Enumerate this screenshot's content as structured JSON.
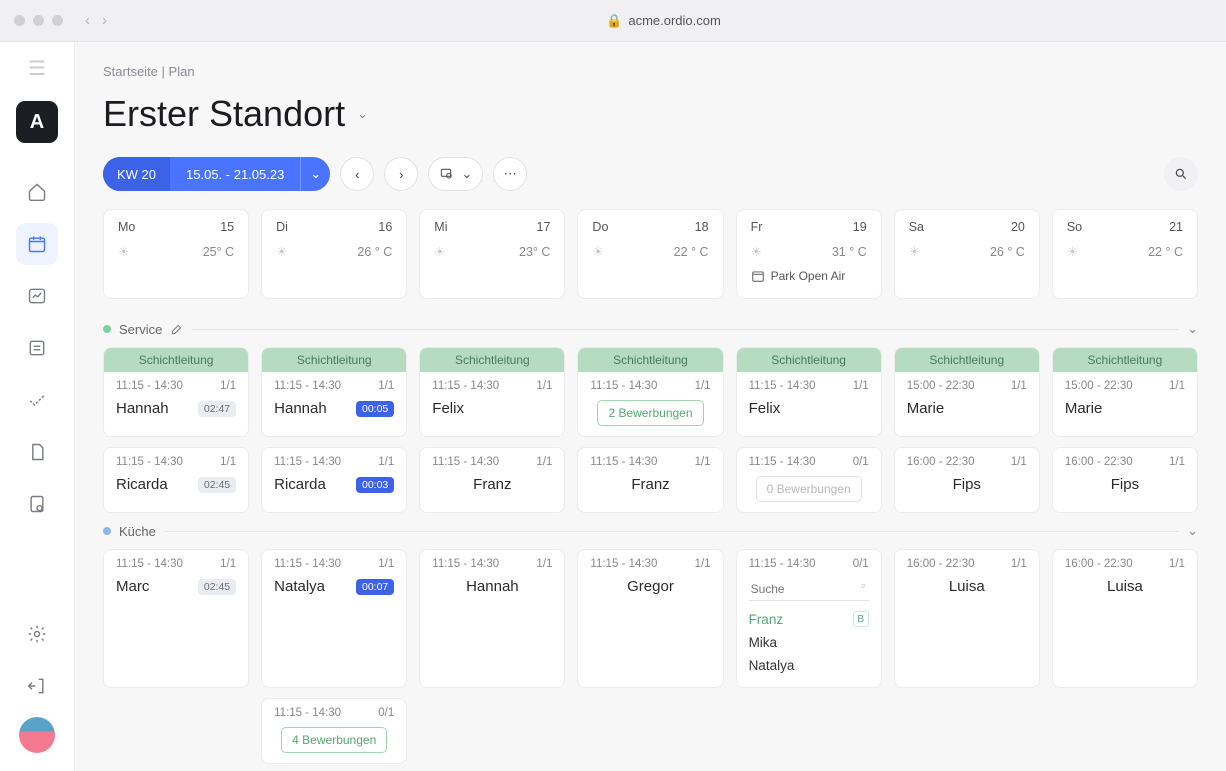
{
  "browser": {
    "url": "acme.ordio.com"
  },
  "logo": "A",
  "breadcrumb": [
    "Startseite",
    "Plan"
  ],
  "title": "Erster Standort",
  "week": {
    "kw": "KW 20",
    "range": "15.05. - 21.05.23"
  },
  "days": [
    {
      "short": "Mo",
      "num": "15",
      "temp": "25° C"
    },
    {
      "short": "Di",
      "num": "16",
      "temp": "26 ° C"
    },
    {
      "short": "Mi",
      "num": "17",
      "temp": "23° C"
    },
    {
      "short": "Do",
      "num": "18",
      "temp": "22 ° C"
    },
    {
      "short": "Fr",
      "num": "19",
      "temp": "31 ° C",
      "event": "Park Open Air"
    },
    {
      "short": "Sa",
      "num": "20",
      "temp": "26 ° C"
    },
    {
      "short": "So",
      "num": "21",
      "temp": "22 ° C"
    }
  ],
  "sections": {
    "service": {
      "label": "Service",
      "color": "#7bd39a",
      "leader_label": "Schichtleitung",
      "row1": [
        {
          "time": "11:15 - 14:30",
          "cap": "1/1",
          "name": "Hannah",
          "timer": "02:47",
          "timer_style": "grey"
        },
        {
          "time": "11:15 - 14:30",
          "cap": "1/1",
          "name": "Hannah",
          "timer": "00:05",
          "timer_style": "blue"
        },
        {
          "time": "11:15 - 14:30",
          "cap": "1/1",
          "name": "Felix"
        },
        {
          "time": "11:15 - 14:30",
          "cap": "1/1",
          "applications": "2 Bewerbungen",
          "app_style": "active"
        },
        {
          "time": "11:15 - 14:30",
          "cap": "1/1",
          "name": "Felix"
        },
        {
          "time": "15:00 - 22:30",
          "cap": "1/1",
          "name": "Marie"
        },
        {
          "time": "15:00 - 22:30",
          "cap": "1/1",
          "name": "Marie"
        }
      ],
      "row2": [
        {
          "time": "11:15 - 14:30",
          "cap": "1/1",
          "name": "Ricarda",
          "timer": "02:45",
          "timer_style": "grey"
        },
        {
          "time": "11:15 - 14:30",
          "cap": "1/1",
          "name": "Ricarda",
          "timer": "00:03",
          "timer_style": "blue"
        },
        {
          "time": "11:15 - 14:30",
          "cap": "1/1",
          "name": "Franz"
        },
        {
          "time": "11:15 - 14:30",
          "cap": "1/1",
          "name": "Franz"
        },
        {
          "time": "11:15 - 14:30",
          "cap": "0/1",
          "applications": "0 Bewerbungen",
          "app_style": "muted"
        },
        {
          "time": "16:00 - 22:30",
          "cap": "1/1",
          "name": "Fips"
        },
        {
          "time": "16:00 - 22:30",
          "cap": "1/1",
          "name": "Fips"
        }
      ]
    },
    "kueche": {
      "label": "Küche",
      "color": "#8fb6f2",
      "row1": [
        {
          "time": "11:15 - 14:30",
          "cap": "1/1",
          "name": "Marc",
          "timer": "02:45",
          "timer_style": "grey"
        },
        {
          "time": "11:15 - 14:30",
          "cap": "1/1",
          "name": "Natalya",
          "timer": "00:07",
          "timer_style": "blue"
        },
        {
          "time": "11:15 - 14:30",
          "cap": "1/1",
          "name": "Hannah"
        },
        {
          "time": "11:15 - 14:30",
          "cap": "1/1",
          "name": "Gregor"
        },
        {
          "time": "11:15 - 14:30",
          "cap": "0/1",
          "picker": {
            "placeholder": "Suche",
            "people": [
              {
                "name": "Franz",
                "match": true,
                "badge": "B"
              },
              {
                "name": "Mika"
              },
              {
                "name": "Natalya"
              }
            ]
          }
        },
        {
          "time": "16:00 - 22:30",
          "cap": "1/1",
          "name": "Luisa"
        },
        {
          "time": "16:00 - 22:30",
          "cap": "1/1",
          "name": "Luisa"
        }
      ],
      "row2": [
        null,
        {
          "time": "11:15 - 14:30",
          "cap": "0/1",
          "applications": "4 Bewerbungen",
          "app_style": "active"
        },
        null,
        null,
        null,
        null,
        null
      ]
    }
  }
}
